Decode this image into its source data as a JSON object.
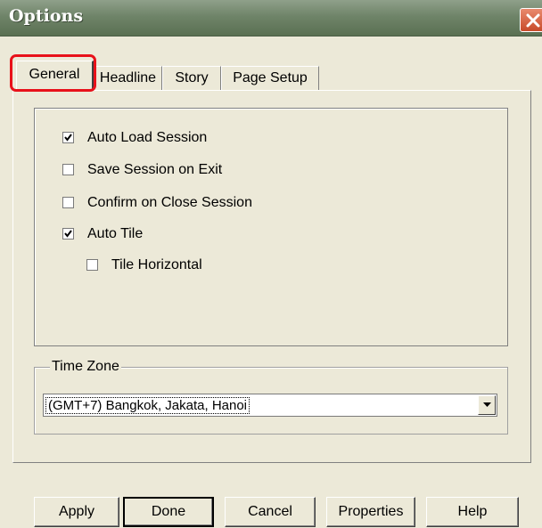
{
  "window": {
    "title": "Options"
  },
  "tabs": [
    {
      "label": "General",
      "active": true
    },
    {
      "label": "Headline",
      "active": false
    },
    {
      "label": "Story",
      "active": false
    },
    {
      "label": "Page Setup",
      "active": false
    }
  ],
  "general": {
    "options": [
      {
        "label": "Auto Load Session",
        "checked": true
      },
      {
        "label": "Save Session on Exit",
        "checked": false
      },
      {
        "label": "Confirm on Close Session",
        "checked": false
      },
      {
        "label": "Auto Tile",
        "checked": true
      },
      {
        "label": "Tile Horizontal",
        "checked": false
      }
    ],
    "time_zone": {
      "legend": "Time Zone",
      "selected": "(GMT+7) Bangkok, Jakata, Hanoi"
    }
  },
  "buttons": {
    "apply": "Apply",
    "done": "Done",
    "cancel": "Cancel",
    "properties": "Properties",
    "help": "Help"
  },
  "colors": {
    "dialog_bg": "#ece9d8",
    "titlebar": "#6f8469",
    "close_button": "#c84a2a",
    "highlight": "#e8111a"
  },
  "icons": {
    "close": "close-icon",
    "checkmark": "checkmark-icon",
    "dropdown": "chevron-down-icon"
  }
}
